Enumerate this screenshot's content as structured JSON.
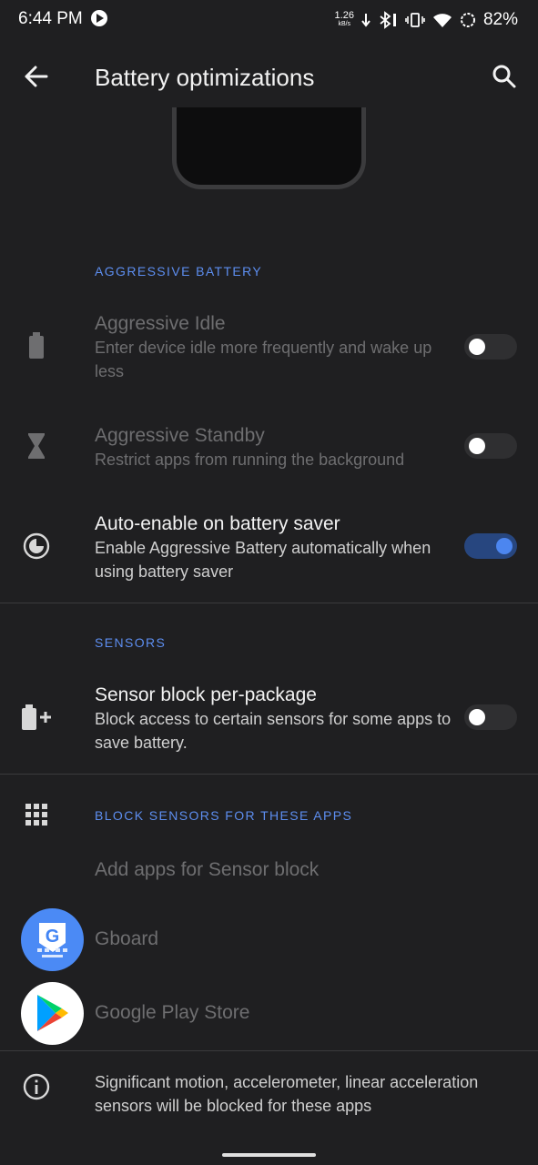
{
  "status_bar": {
    "time": "6:44 PM",
    "net_speed_value": "1.26",
    "net_speed_unit": "kB/s",
    "battery_percent": "82%"
  },
  "app_bar": {
    "title": "Battery optimizations",
    "back_icon": "arrow-back-icon",
    "search_icon": "search-icon"
  },
  "sections": {
    "aggressive": {
      "header": "AGGRESSIVE BATTERY",
      "items": [
        {
          "title": "Aggressive Idle",
          "subtitle": "Enter device idle more frequently and wake up less",
          "enabled": false,
          "icon": "battery-icon"
        },
        {
          "title": "Aggressive Standby",
          "subtitle": "Restrict apps from running the background",
          "enabled": false,
          "icon": "hourglass-icon"
        },
        {
          "title": "Auto-enable on battery saver",
          "subtitle": "Enable Aggressive Battery automatically when using battery saver",
          "enabled": true,
          "icon": "battery-saver-icon"
        }
      ]
    },
    "sensors": {
      "header": "SENSORS",
      "items": [
        {
          "title": "Sensor block per-package",
          "subtitle": "Block access to certain sensors for some apps to save battery.",
          "enabled": false,
          "icon": "battery-plus-icon"
        }
      ]
    },
    "block_apps": {
      "header": "BLOCK SENSORS FOR THESE APPS",
      "icon": "grid-icon",
      "add_label": "Add apps for Sensor block",
      "apps": [
        {
          "name": "Gboard",
          "icon": "gboard-icon"
        },
        {
          "name": "Google Play Store",
          "icon": "play-store-icon"
        }
      ]
    }
  },
  "footer": {
    "info_icon": "info-icon",
    "info_text": "Significant motion, accelerometer, linear acceleration sensors will be blocked for these apps"
  },
  "colors": {
    "background": "#1f1f21",
    "accent": "#5d8ef0",
    "switch_on_track": "#27467f",
    "switch_on_thumb": "#4c86f0"
  }
}
